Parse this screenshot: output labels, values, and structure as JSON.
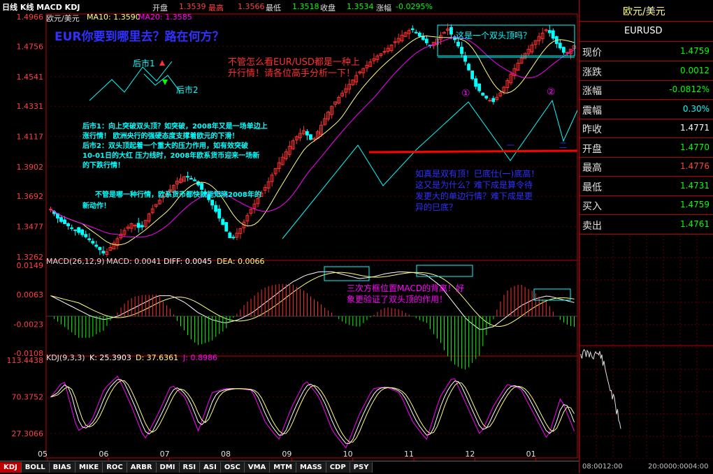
{
  "topbar": {
    "title": "日线 K线 MACD KDJ",
    "open_label": "开盘",
    "open_value": "1.3539",
    "high_label": "最高",
    "high_value": "1.3566",
    "low_label": "最低",
    "low_value": "1.3518",
    "close_label": "收盘",
    "close_value": "1.3534",
    "change_label": "涨幅",
    "change_value": "-0.0295%"
  },
  "main_legend": {
    "symbol": "欧元/美元",
    "ma10": "MA10: 1.3590",
    "ma20": "MA20: 1.3585"
  },
  "macd_legend": {
    "name": "MACD(26,12,9)",
    "macd": "MACD: 0.0041",
    "diff": "DIFF: 0.0045",
    "dea": "DEA: 0.0066"
  },
  "kdj_legend": {
    "name": "KDJ(9,3,3)",
    "k": "K: 25.3903",
    "d": "D: 37.6361",
    "j": "J: 0.8986"
  },
  "annotations": {
    "headline": "EUR你要到哪里去？路在何方？",
    "up_trend": "不管怎么看EUR/USD都是一种上",
    "up_trend2": "升行情！请各位高手分析一下！",
    "double_top": "这是一个双头顶吗？",
    "future1": "后市1",
    "future2": "后市2",
    "scenario1": "后市1：向上突破双头顶？如突破，2008年又是一场单边上",
    "scenario1b": "涨行情！    欧洲央行的强硬态度支撑着欧元的下滑！",
    "scenario2": "后市2：双头顶起着一个重大的压力作用，如有效突破",
    "scenario2b": "10-01日的大红       压力线时，2008年欧系货币迎来一场新",
    "scenario2c": "的下跌行情！",
    "either": "不管是哪一种行情，欧系货币都快就能知晓2008年的",
    "either2": "新动作！",
    "neck_q1": "如真是双有顶！巳底仕(一)底高！",
    "neck_q2": "这又是为什么？难下成是算令待",
    "neck_q3": "发更大的单边行情？难下成是更",
    "neck_q4": "异的巳底？",
    "macd_note1": "三次方框位置MACD的背离！好",
    "macd_note2": "象更验证了双头顶的作用！",
    "circle1": "①",
    "circle2": "②",
    "mark1": "一",
    "mark2": "二"
  },
  "side": {
    "name": "欧元/美元",
    "code": "EURUSD",
    "quotes": [
      {
        "label": "现价",
        "value": "1.4759",
        "color": "#00ff00"
      },
      {
        "label": "涨跌",
        "value": "0.0012",
        "color": "#00ff00"
      },
      {
        "label": "涨幅",
        "value": "-0.0812%",
        "color": "#00ff00"
      },
      {
        "label": "震幅",
        "value": "0.30%",
        "color": "#00ffff"
      },
      {
        "label": "昨收",
        "value": "1.4771",
        "color": "#ffffff"
      },
      {
        "label": "开盘",
        "value": "1.4770",
        "color": "#00ff00"
      },
      {
        "label": "最高",
        "value": "1.4776",
        "color": "#ff4040"
      },
      {
        "label": "最低",
        "value": "1.4731",
        "color": "#00ff00"
      },
      {
        "label": "买入",
        "value": "1.4759",
        "color": "#00ff00"
      },
      {
        "label": "卖出",
        "value": "1.4761",
        "color": "#00ff00"
      }
    ],
    "time_left": "08:0012:00",
    "time_right": "20:0000:0004:00"
  },
  "tabs": [
    "KDJ",
    "BOLL",
    "BIAS",
    "MIKE",
    "ROC",
    "ARBR",
    "DMI",
    "RSI",
    "ASI",
    "OSC",
    "VMA",
    "MTM",
    "MASS",
    "CDP",
    "PSY"
  ],
  "colors": {
    "up": "#ff3030",
    "down": "#00ffff",
    "ma10": "#ffff80",
    "ma20": "#ff00ff",
    "axis": "#c00000"
  },
  "chart_data": [
    {
      "type": "candlestick",
      "title": "欧元/美元",
      "x_ticks": [
        "05",
        "06",
        "07",
        "08",
        "09",
        "10",
        "11",
        "12",
        "01"
      ],
      "y_ticks": [
        1.4966,
        1.4756,
        1.4541,
        1.4331,
        1.4117,
        1.3902,
        1.3692,
        1.3477,
        1.3262
      ],
      "ylim": [
        1.3262,
        1.4966
      ],
      "series": [
        {
          "name": "MA10",
          "value": 1.359
        },
        {
          "name": "MA20",
          "value": 1.3585
        }
      ],
      "path": [
        1.36,
        1.352,
        1.348,
        1.344,
        1.34,
        1.334,
        1.328,
        1.336,
        1.344,
        1.35,
        1.346,
        1.358,
        1.366,
        1.372,
        1.38,
        1.384,
        1.38,
        1.372,
        1.362,
        1.35,
        1.338,
        1.346,
        1.358,
        1.368,
        1.378,
        1.39,
        1.4,
        1.41,
        1.416,
        1.408,
        1.42,
        1.432,
        1.44,
        1.448,
        1.456,
        1.462,
        1.468,
        1.472,
        1.478,
        1.484,
        1.488,
        1.482,
        1.476,
        1.482,
        1.488,
        1.478,
        1.464,
        1.448,
        1.44,
        1.436,
        1.444,
        1.456,
        1.466,
        1.474,
        1.482,
        1.488,
        1.478,
        1.47,
        1.476
      ]
    },
    {
      "type": "bar",
      "title": "MACD(26,12,9)",
      "y_ticks": [
        0.0149,
        0.0063,
        -0.0023,
        -0.0108
      ],
      "ylim": [
        -0.0108,
        0.0149
      ],
      "series": [
        {
          "name": "MACD",
          "value": 0.0041
        },
        {
          "name": "DIFF",
          "value": 0.0045
        },
        {
          "name": "DEA",
          "value": 0.0066
        }
      ],
      "path": [
        0.006,
        0.004,
        0.002,
        0.0,
        -0.001,
        0.0,
        0.002,
        0.004,
        0.006,
        0.006,
        0.004,
        0.001,
        -0.001,
        -0.002,
        -0.001,
        0.001,
        0.004,
        0.007,
        0.01,
        0.012,
        0.013,
        0.013,
        0.012,
        0.011,
        0.0115,
        0.0125,
        0.013,
        0.0128,
        0.012,
        0.009,
        0.004,
        -0.001,
        -0.004,
        -0.003,
        0.0,
        0.003,
        0.005,
        0.006,
        0.005,
        0.004
      ]
    },
    {
      "type": "line",
      "title": "KDJ(9,3,3)",
      "y_ticks": [
        113.4438,
        70.3752,
        27.3066
      ],
      "ylim": [
        0,
        113.4438
      ],
      "series": [
        {
          "name": "K",
          "value": 25.3903
        },
        {
          "name": "D",
          "value": 37.6361
        },
        {
          "name": "J",
          "value": 0.8986
        }
      ],
      "path": [
        70,
        90,
        30,
        40,
        80,
        95,
        60,
        20,
        50,
        85,
        70,
        30,
        75,
        80,
        80,
        78,
        40,
        20,
        60,
        90,
        70,
        30,
        10,
        50,
        80,
        82,
        75,
        40,
        20,
        70,
        95,
        60,
        25,
        60,
        85,
        80,
        50,
        20,
        70,
        30
      ]
    }
  ]
}
